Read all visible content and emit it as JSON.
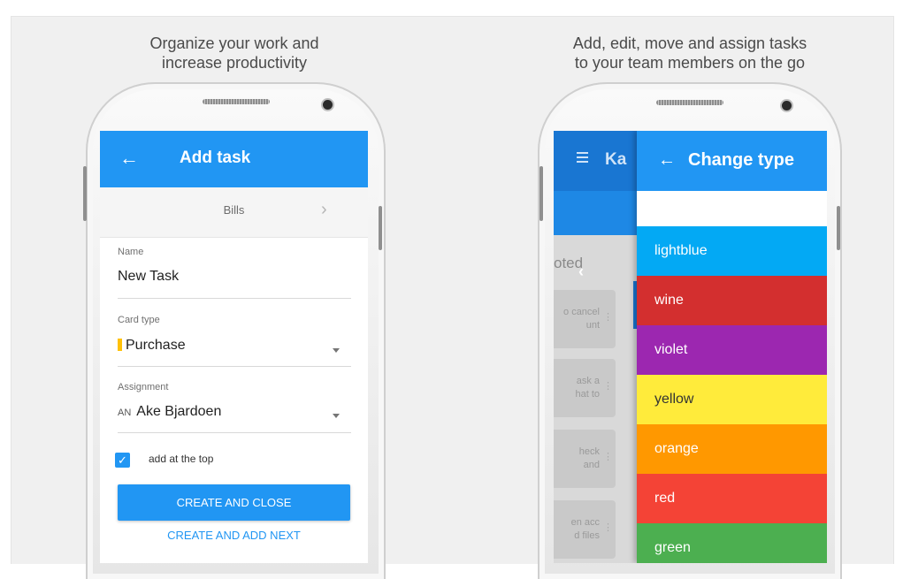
{
  "captions": {
    "left": [
      "Organize your work and",
      "increase productivity"
    ],
    "right": [
      "Add, edit, move and assign tasks",
      "to your team members on the go"
    ]
  },
  "add_task": {
    "title": "Add task",
    "back_icon": "arrow-left-icon",
    "board": "Bills",
    "name_label": "Name",
    "name_value": "New Task",
    "card_type_label": "Card type",
    "card_type_value": "Purchase",
    "card_type_color": "#ffc107",
    "assignment_label": "Assignment",
    "assignee_initials": "AN",
    "assignee_name": "Ake Bjardoen",
    "add_at_top_label": "add at the top",
    "add_at_top_checked": true,
    "create_close_label": "CREATE AND CLOSE",
    "create_next_label": "CREATE AND ADD NEXT",
    "accent_color": "#2196f3"
  },
  "board": {
    "title_partial": "Ka",
    "column_header_partial": "oted",
    "cards": [
      {
        "line1": "o cancel",
        "line2": "unt"
      },
      {
        "line1": "ask a",
        "line2": "hat to"
      },
      {
        "line1": "heck",
        "line2": "and"
      },
      {
        "line1": "en acc",
        "line2": "d files"
      }
    ]
  },
  "change_type": {
    "title": "Change type",
    "types": [
      {
        "label": "",
        "color": "#ffffff"
      },
      {
        "label": "lightblue",
        "color": "#03a9f4"
      },
      {
        "label": "wine",
        "color": "#d32f2f"
      },
      {
        "label": "violet",
        "color": "#9c27b0"
      },
      {
        "label": "yellow",
        "color": "#ffeb3b"
      },
      {
        "label": "orange",
        "color": "#ff9800"
      },
      {
        "label": "red",
        "color": "#f44336"
      },
      {
        "label": "green",
        "color": "#4caf50"
      }
    ]
  }
}
